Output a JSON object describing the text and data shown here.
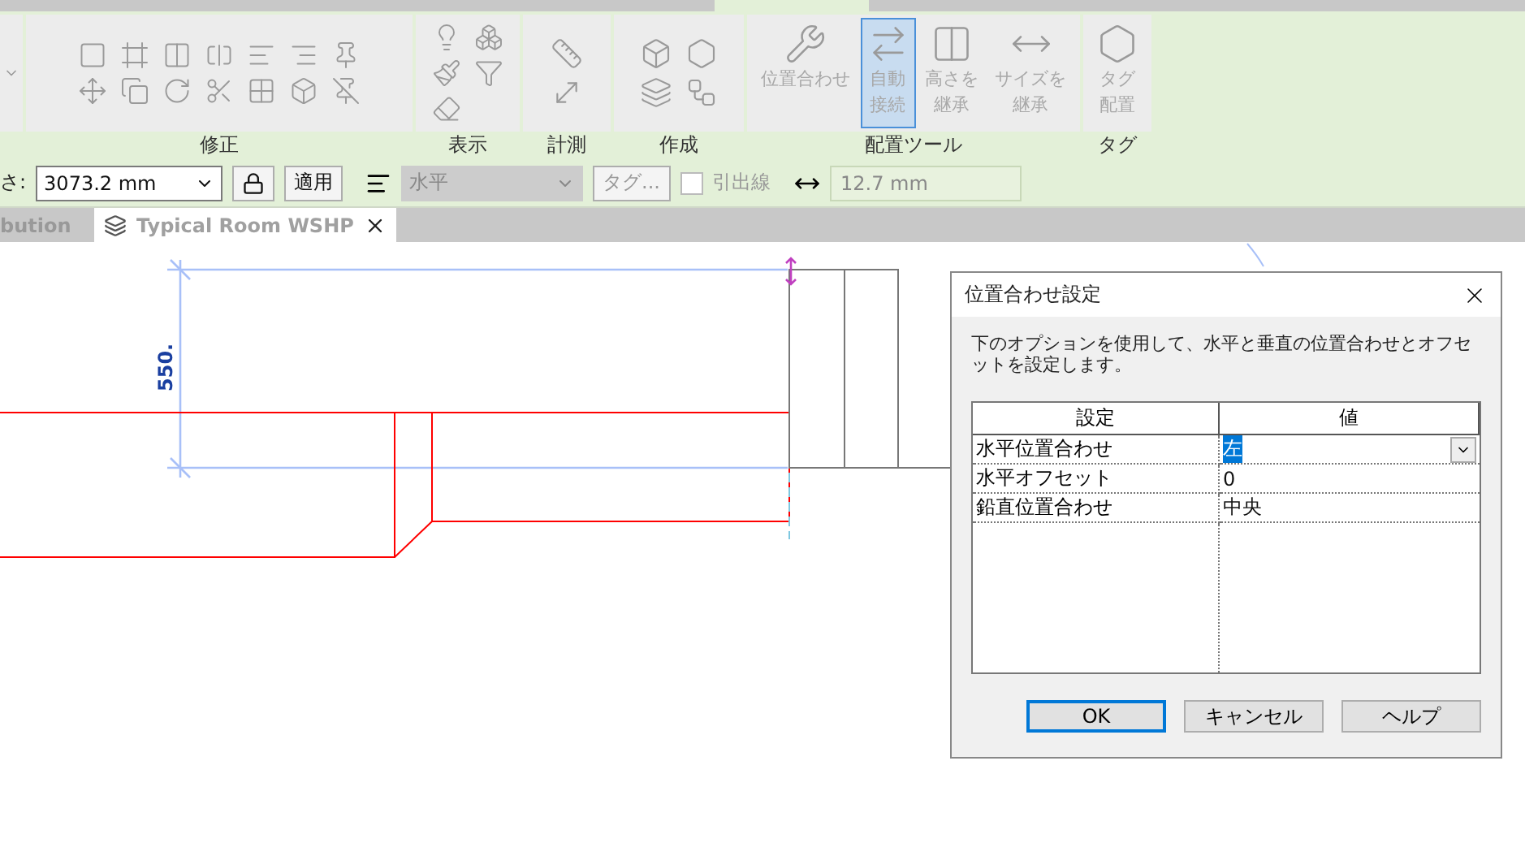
{
  "ribbon": {
    "panels": [
      {
        "label": "修正",
        "kind": "icons"
      },
      {
        "label": "表示",
        "kind": "icons"
      },
      {
        "label": "計測",
        "kind": "icons"
      },
      {
        "label": "作成",
        "kind": "icons"
      }
    ],
    "placement_panel": {
      "label": "配置ツール",
      "buttons": [
        {
          "lines": [
            "位置合わせ"
          ],
          "selected": false,
          "disabled": true
        },
        {
          "lines": [
            "自動",
            "接続"
          ],
          "selected": true,
          "disabled": true
        },
        {
          "lines": [
            "高さを",
            "継承"
          ],
          "selected": false,
          "disabled": true
        },
        {
          "lines": [
            "サイズを",
            "継承"
          ],
          "selected": false,
          "disabled": true
        }
      ]
    },
    "tag_panel": {
      "label": "タグ",
      "buttons": [
        {
          "lines": [
            "タグ",
            "配置"
          ],
          "selected": false,
          "disabled": true
        }
      ]
    }
  },
  "options_bar": {
    "size_label": "さ:",
    "size_value": "3073.2 mm",
    "apply_button": "適用",
    "orientation_value": "水平",
    "orientation_disabled": true,
    "tag_button": "タグ...",
    "leader_label": "引出線",
    "leader_checked": false,
    "leader_disabled": true,
    "offset_value": "12.7 mm"
  },
  "view_tabs": [
    {
      "label": "bution",
      "selected": false
    },
    {
      "label": "Typical Room WSHP",
      "selected": true
    }
  ],
  "canvas": {
    "dimension": "550."
  },
  "dialog": {
    "title": "位置合わせ設定",
    "description": "下のオプションを使用して、水平と垂直の位置合わせとオフセットを設定します。",
    "columns": [
      "設定",
      "値"
    ],
    "rows": [
      {
        "setting": "水平位置合わせ",
        "value": "左",
        "selected": true
      },
      {
        "setting": "水平オフセット",
        "value": "0",
        "selected": false
      },
      {
        "setting": "鉛直位置合わせ",
        "value": "中央",
        "selected": false
      }
    ],
    "buttons": [
      {
        "label": "OK",
        "default": true
      },
      {
        "label": "キャンセル",
        "default": false
      },
      {
        "label": "ヘルプ",
        "default": false
      }
    ]
  }
}
